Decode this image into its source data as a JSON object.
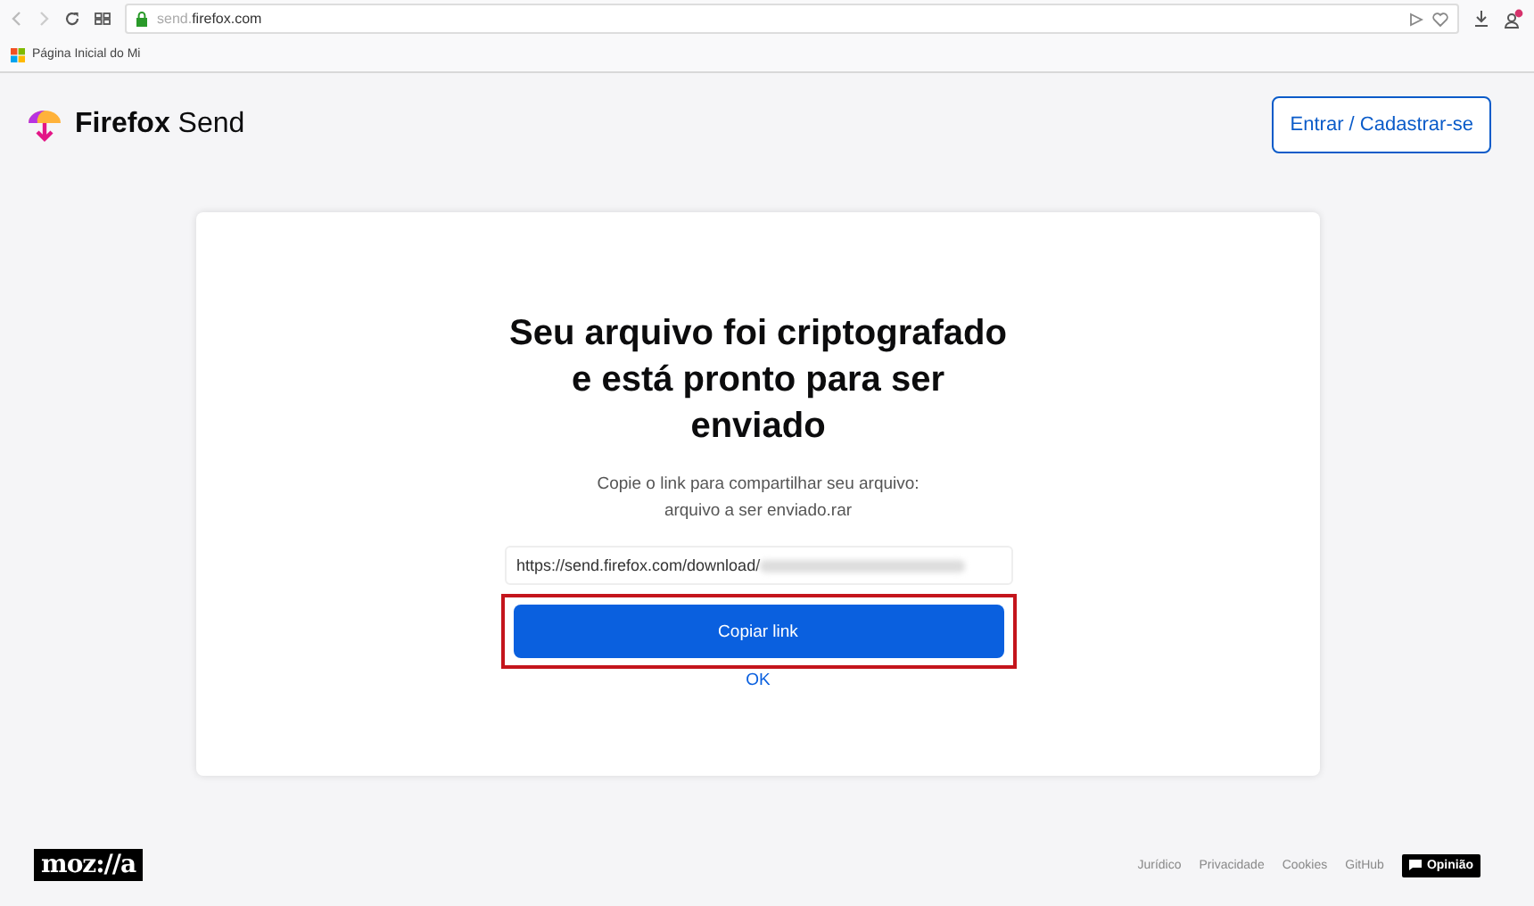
{
  "browser": {
    "url_dim": "send.",
    "url": "firefox.com",
    "bookmarks": [
      {
        "label": "Página Inicial do Mi"
      }
    ]
  },
  "header": {
    "brand_bold": "Firefox",
    "brand": "Send",
    "login_button": "Entrar / Cadastrar-se"
  },
  "card": {
    "title": "Seu arquivo foi criptografado e está pronto para ser enviado",
    "description": "Copie o link para compartilhar seu arquivo:",
    "file_name": "arquivo a ser enviado.rar",
    "link": "https://send.firefox.com/download/",
    "copy_button": "Copiar link",
    "highlighted": true,
    "ok_link": "OK"
  },
  "footer": {
    "logo": "moz://a",
    "links": [
      "Jurídico",
      "Privacidade",
      "Cookies",
      "GitHub"
    ],
    "feedback_button": "Opinião"
  }
}
